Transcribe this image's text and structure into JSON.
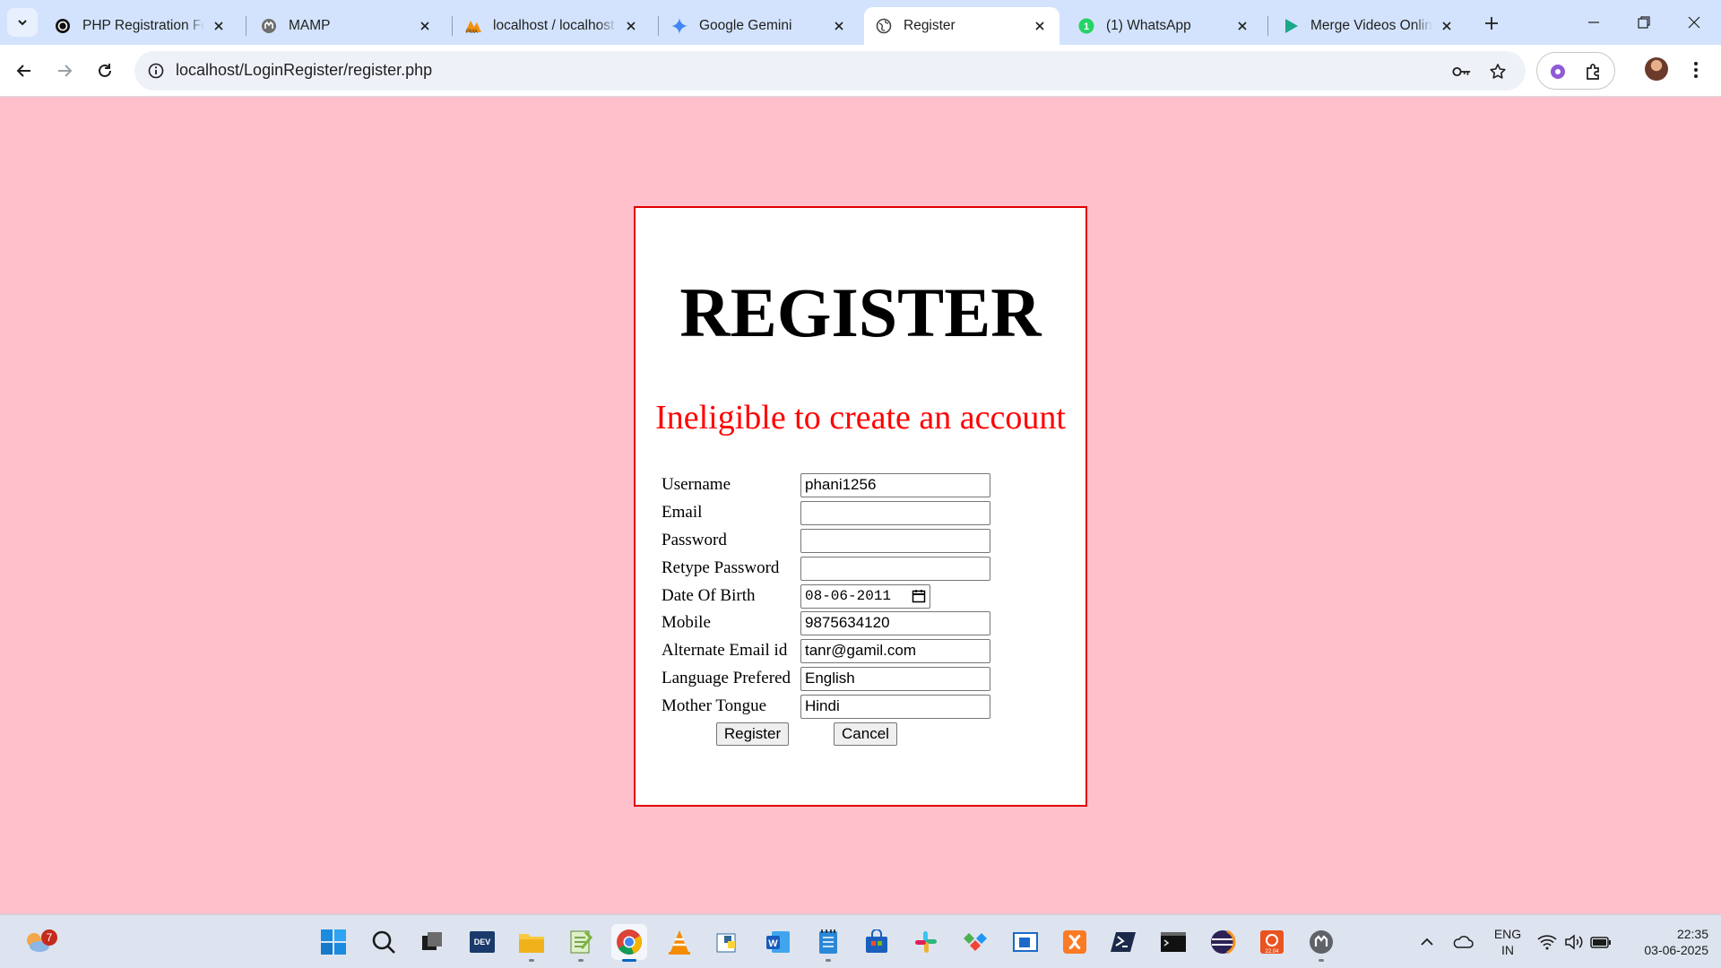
{
  "browser": {
    "tabs": [
      {
        "title": "PHP Registration For",
        "icon": "openai-icon"
      },
      {
        "title": "MAMP",
        "icon": "mamp-icon"
      },
      {
        "title": "localhost / localhost",
        "icon": "phpmyadmin-icon"
      },
      {
        "title": "Google Gemini",
        "icon": "gemini-icon"
      },
      {
        "title": "Register",
        "icon": "globe-icon",
        "active": true
      },
      {
        "title": "(1) WhatsApp",
        "icon": "whatsapp-icon"
      },
      {
        "title": "Merge Videos Online",
        "icon": "play-icon"
      }
    ],
    "url": "localhost/LoginRegister/register.php"
  },
  "form": {
    "title": "REGISTER",
    "error": "Ineligible to create an account",
    "fields": [
      {
        "label": "Username",
        "value": "phani1256"
      },
      {
        "label": "Email",
        "value": ""
      },
      {
        "label": "Password",
        "value": ""
      },
      {
        "label": "Retype Password",
        "value": ""
      },
      {
        "label": "Date Of Birth",
        "value": "08-06-2011"
      },
      {
        "label": "Mobile",
        "value": "9875634120"
      },
      {
        "label": "Alternate Email id",
        "value": "tanr@gamil.com"
      },
      {
        "label": "Language Prefered",
        "value": "English"
      },
      {
        "label": "Mother Tongue",
        "value": "Hindi"
      }
    ],
    "register_label": "Register",
    "cancel_label": "Cancel"
  },
  "taskbar": {
    "weather_badge": "7",
    "language": "ENG",
    "region": "IN",
    "time": "22:35",
    "date": "03-06-2025"
  },
  "colors": {
    "page_background": "#ffc0cb",
    "box_border": "#e00000",
    "error_text": "#ff0000",
    "tabstrip": "#d3e3fd"
  }
}
